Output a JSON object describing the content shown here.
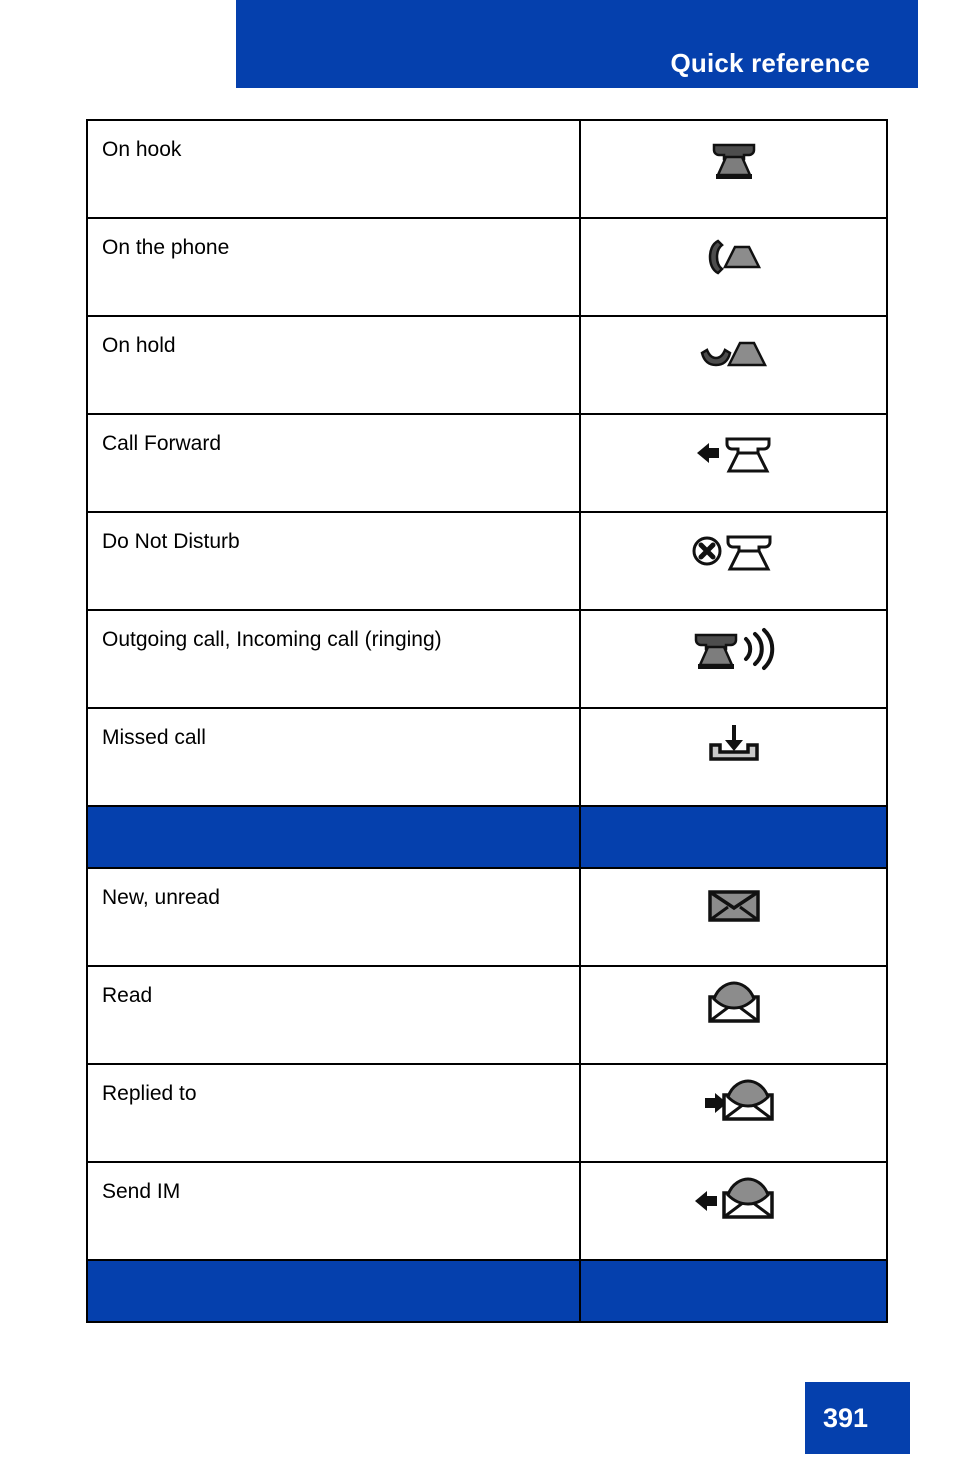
{
  "header": {
    "title": "Quick reference"
  },
  "table": {
    "rows": [
      {
        "type": "content",
        "label": "On hook",
        "icon": "phone-on-hook-icon"
      },
      {
        "type": "content",
        "label": "On the phone",
        "icon": "phone-off-hook-icon"
      },
      {
        "type": "content",
        "label": "On hold",
        "icon": "phone-on-hold-icon"
      },
      {
        "type": "content",
        "label": "Call Forward",
        "icon": "call-forward-icon"
      },
      {
        "type": "content",
        "label": "Do Not Disturb",
        "icon": "do-not-disturb-icon"
      },
      {
        "type": "content",
        "label": "Outgoing call, Incoming call (ringing)",
        "icon": "phone-ringing-icon"
      },
      {
        "type": "content",
        "label": "Missed call",
        "icon": "missed-call-inbox-icon"
      },
      {
        "type": "separator",
        "label": "",
        "icon": ""
      },
      {
        "type": "content",
        "label": "New, unread",
        "icon": "envelope-closed-icon"
      },
      {
        "type": "content",
        "label": "Read",
        "icon": "envelope-open-icon"
      },
      {
        "type": "content",
        "label": "Replied to",
        "icon": "envelope-reply-icon"
      },
      {
        "type": "content",
        "label": "Send IM",
        "icon": "envelope-send-icon"
      },
      {
        "type": "separator",
        "label": "",
        "icon": ""
      }
    ]
  },
  "footer": {
    "page_number": "391"
  },
  "colors": {
    "brand_blue": "#0540AD",
    "icon_dark": "#1a1a1a",
    "icon_gray": "#8c8c8c",
    "border": "#000000",
    "text": "#000000"
  }
}
